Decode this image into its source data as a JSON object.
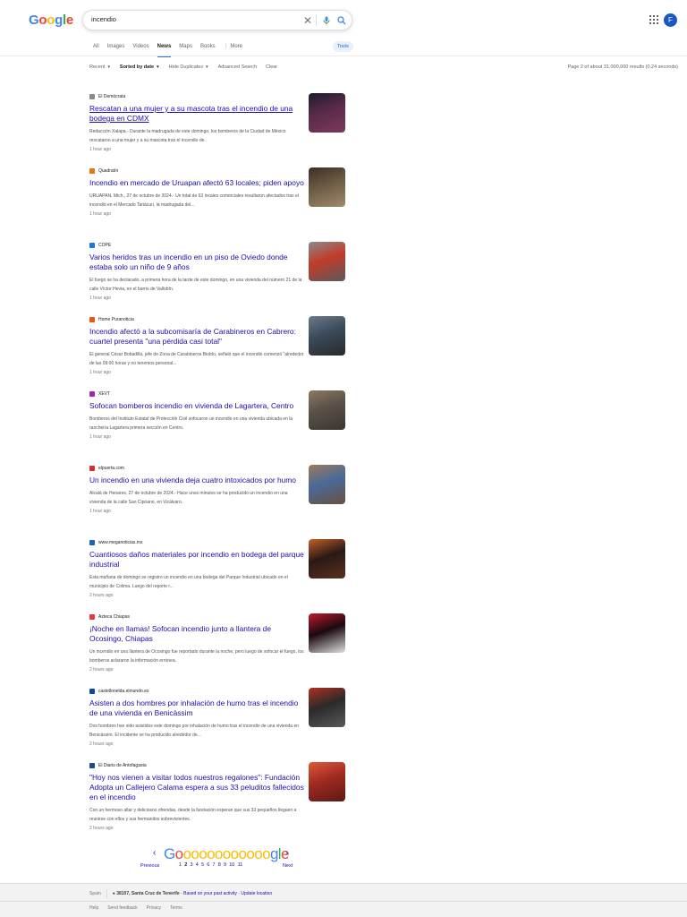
{
  "header": {
    "logo_letters": [
      "G",
      "o",
      "o",
      "g",
      "l",
      "e"
    ],
    "logo_colors": [
      "#4285f4",
      "#ea4335",
      "#fbbc05",
      "#4285f4",
      "#34a853",
      "#ea4335"
    ],
    "search_value": "incendio",
    "avatar_letter": "F"
  },
  "tabs": [
    {
      "label": "All",
      "active": false
    },
    {
      "label": "Images",
      "active": false
    },
    {
      "label": "Videos",
      "active": false
    },
    {
      "label": "News",
      "active": true
    },
    {
      "label": "Maps",
      "active": false
    },
    {
      "label": "Books",
      "active": false
    },
    {
      "label": "⋮ More",
      "active": false
    }
  ],
  "tools_label": "Tools",
  "filters": {
    "recent": "Recent",
    "sorted": "Sorted by date",
    "hide_dupes": "Hide Duplicates",
    "advanced": "Advanced Search",
    "clear": "Clear",
    "stats": "Page 2 of about 31,000,000 results (0.24 seconds)"
  },
  "results": [
    {
      "source": "El Demócrata",
      "favicon_color": "#8a8a8a",
      "title": "Rescatan a una mujer y a su mascota tras el incendio de una bodega en CDMX",
      "visited": true,
      "snippet": "Redacción Xalapa.- Durante la madrugada de este domingo, los bomberos de la Ciudad de México rescataron a una mujer y a su mascota tras el incendio de.",
      "time": "1 hour ago",
      "thumb_colors": [
        "#5a2a4a",
        "#1c1c2e",
        "#7a3a5a"
      ]
    },
    {
      "source": "Quadratín",
      "favicon_color": "#e8711c",
      "title": "Incendio en mercado de Uruapan afectó 63 locales; piden apoyo",
      "visited": false,
      "snippet": "URUAPAN, Mich., 27 de octubre de 2024.- Un total de 63 locales comerciales resultaron afectados tras el incendio en el Mercado Tariácuri, la madrugada del...",
      "time": "1 hour ago",
      "thumb_colors": [
        "#6b5a44",
        "#3b3024",
        "#a08a6a"
      ]
    },
    {
      "source": "COPE",
      "favicon_color": "#1a73e8",
      "title": "Varios heridos tras un incendio en un piso de Oviedo donde estaba solo un niño de 9 años",
      "visited": false,
      "snippet": "El fuego se ha declarado, a primera hora de la tarde de este domingo, en una vivienda del número 21 de la calle Víctor Hevia, en el barrio de Vallobín.",
      "time": "1 hour ago",
      "thumb_colors": [
        "#c23b2a",
        "#8a8a8a",
        "#5a5a5a"
      ]
    },
    {
      "source": "Home Puranoticia",
      "favicon_color": "#e8541c",
      "title": "Incendio afectó a la subcomisaría de Carabineros en Cabrero: cuartel presenta \"una pérdida casi total\"",
      "visited": false,
      "snippet": "El general César Bobadilla, jefe de Zona de Carabineros Biobío, señaló que el incendio comenzó \"alrededor de las 09:00 horas y no tenemos personal...",
      "time": "1 hour ago",
      "thumb_colors": [
        "#3a4a5a",
        "#6a7a8a",
        "#2a2a2a"
      ]
    },
    {
      "source": "XEVT",
      "favicon_color": "#9c27b0",
      "title": "Sofocan bomberos incendio en vivienda de Lagartera, Centro",
      "visited": false,
      "snippet": "Bomberos del Instituto Estatal de Protección Civil sofocaron un incendio en una vivienda ubicada en la ranchería Lagartera primera sección en Centro.",
      "time": "1 hour ago",
      "thumb_colors": [
        "#5a5048",
        "#8a7a60",
        "#3a3530"
      ]
    },
    {
      "source": "elpuerta.com",
      "favicon_color": "#d32f2f",
      "title": "Un incendio en una vivienda deja cuatro intoxicados por humo",
      "visited": false,
      "snippet": "Alcalá de Henares, 27 de octubre de 2024.- Hace unos minutos se ha producido un incendio en una vivienda de la calle San Cipriano, en Vicálvaro.",
      "time": "1 hour ago",
      "thumb_colors": [
        "#4a6a9a",
        "#a07a5a",
        "#6a5040"
      ]
    },
    {
      "source": "www.meganoticias.mx",
      "favicon_color": "#1565c0",
      "title": "Cuantiosos daños materiales por incendio en bodega del parque industrial",
      "visited": false,
      "snippet": "Esta mañana de domingo se registro un incendio en una bodega del Parque Industrial ubicado en el municipio de Colima. Luego del reporte r...",
      "time": "2 hours ago",
      "thumb_colors": [
        "#2a1a14",
        "#c0602a",
        "#5a3020"
      ]
    },
    {
      "source": "Azteca Chiapas",
      "favicon_color": "#e53935",
      "title": "¡Noche en llamas! Sofocan incendio junto a llantera de Ocosingo, Chiapas",
      "visited": false,
      "snippet": "Un incendio en una llantera de Ocosingo fue reportado durante la noche, pero luego de sofocar el fuego, los bomberos aclararon la información errónea.",
      "time": "2 hours ago",
      "thumb_colors": [
        "#1a0a10",
        "#c01a2a",
        "#e0e0e0"
      ]
    },
    {
      "source": "castellonelda.elmundo.es",
      "favicon_color": "#0d47a1",
      "title": "Asisten a dos hombres por inhalación de humo tras el incendio de una vivienda en Benicàssim",
      "visited": false,
      "snippet": "Dos hombres han sido asistidos este domingo por inhalación de humo tras el incendio de una vivienda en Benicàssim. El incidente se ha producido alrededor de...",
      "time": "2 hours ago",
      "thumb_colors": [
        "#2a2a2a",
        "#b03020",
        "#5a5a5a"
      ]
    },
    {
      "source": "El Diario de Antofagasta",
      "favicon_color": "#1e4a8a",
      "title": "\"Hoy nos vienen a visitar todos nuestros regalones\": Fundación Adopta un Callejero Calama espera a sus 33 peluditos fallecidos en el incendio",
      "visited": false,
      "snippet": "Con un hermoso altar y deliciosos ofrendas, desde la fundación esperan que sus 33 pequeños lleguen a reunirse con ellos y sus hermanitos sobrevivientes.",
      "time": "2 hours ago",
      "thumb_colors": [
        "#a02a20",
        "#e05a3a",
        "#5a1a14"
      ]
    }
  ],
  "pager": {
    "logo_text": "Goooooooooooogle",
    "prev_arrow": "‹",
    "next_arrow": "›",
    "previous": "Previous",
    "next": "Next",
    "pages": [
      "1",
      "2",
      "3",
      "4",
      "5",
      "6",
      "7",
      "8",
      "9",
      "10",
      "11"
    ],
    "current": "2"
  },
  "footer": {
    "country": "Spain",
    "location": "● 38107, Santa Cruz de Tenerife",
    "based_on": "Based on your past activity",
    "update": "Update location",
    "links": [
      "Help",
      "Send feedback",
      "Privacy",
      "Terms"
    ]
  }
}
